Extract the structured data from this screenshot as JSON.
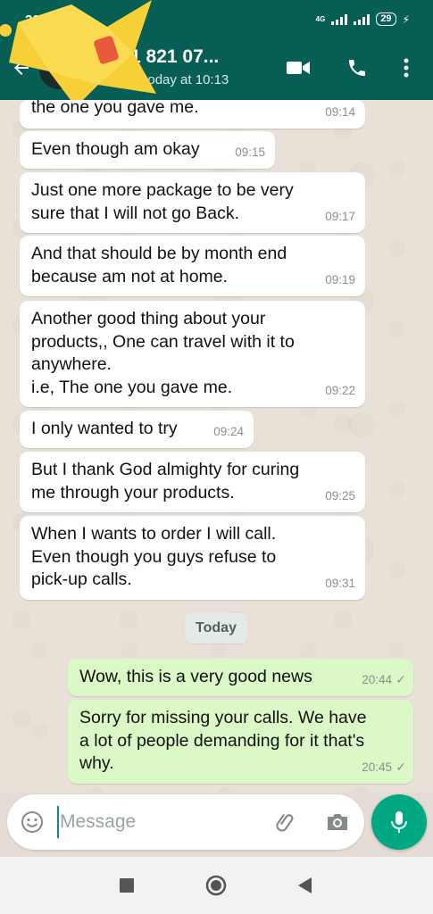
{
  "status_bar": {
    "time": "20:45",
    "network": "4G",
    "battery": "29"
  },
  "header": {
    "contact_name": "1 821 07...",
    "last_seen": "een today at 10:13",
    "colors": {
      "header_bg": "#075e54",
      "accent": "#00a884"
    },
    "icons": [
      "back-arrow-icon",
      "video-call-icon",
      "voice-call-icon",
      "more-options-icon"
    ]
  },
  "messages": [
    {
      "direction": "in",
      "text": "the one you gave me.",
      "time": "09:14"
    },
    {
      "direction": "in",
      "text": "Even though am okay",
      "time": "09:15"
    },
    {
      "direction": "in",
      "text": "Just one more package to be very\nsure that I will not go Back.",
      "time": "09:17"
    },
    {
      "direction": "in",
      "text": "And that should be by month end\nbecause am not at home.",
      "time": "09:19"
    },
    {
      "direction": "in",
      "text": "Another good thing about your\nproducts,, One can travel with it to\nanywhere.\ni.e, The one you gave me.",
      "time": "09:22"
    },
    {
      "direction": "in",
      "text": "I only wanted to try",
      "time": "09:24"
    },
    {
      "direction": "in",
      "text": "But I thank God almighty for curing\nme through your products.",
      "time": "09:25"
    },
    {
      "direction": "in",
      "text": "When I wants to order I will call.\nEven though you guys refuse to\npick-up calls.",
      "time": "09:31"
    },
    {
      "direction": "out",
      "text": "Wow, this is a very good news",
      "time": "20:44"
    },
    {
      "direction": "out",
      "text": "Sorry for missing your calls. We have\na lot of people demanding for it that's\nwhy.",
      "time": "20:45"
    }
  ],
  "date_divider": "Today",
  "composer": {
    "placeholder": "Message",
    "icons": [
      "emoji-icon",
      "attach-icon",
      "camera-icon",
      "mic-icon"
    ]
  },
  "navbar": {
    "icons": [
      "recents-icon",
      "home-icon",
      "back-icon"
    ]
  }
}
